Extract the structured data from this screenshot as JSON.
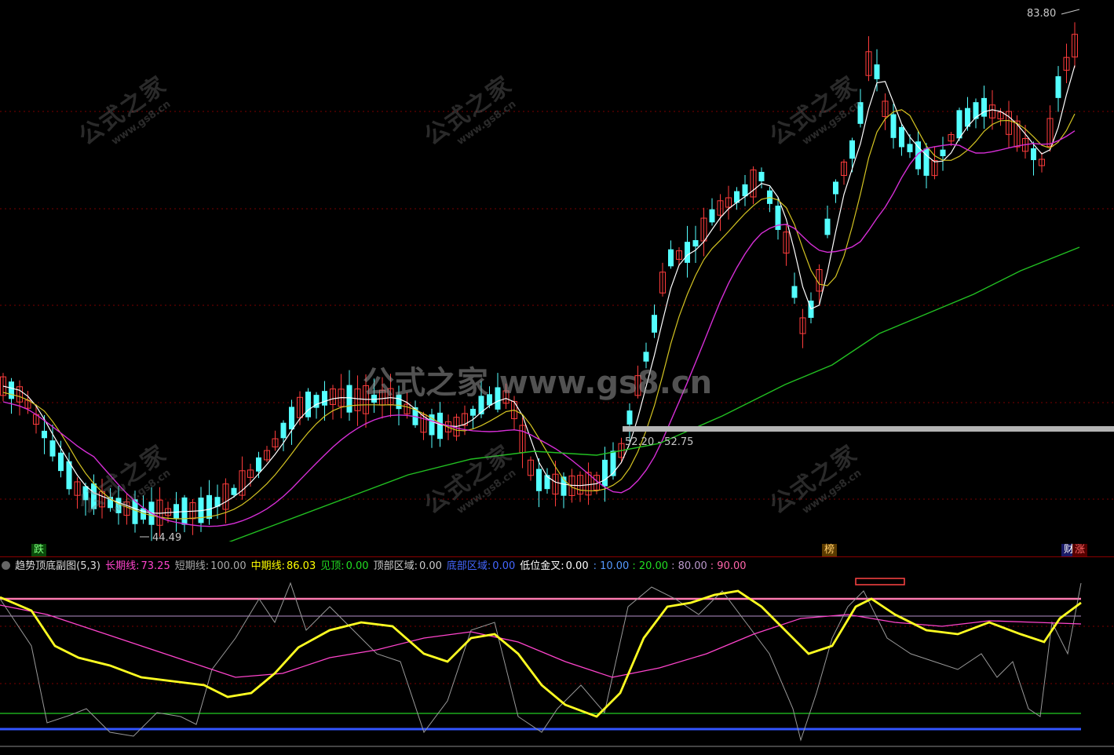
{
  "colors": {
    "up": "#ff3c3c",
    "down": "#54ffff",
    "ma5": "#ffffff",
    "ma10": "#d4c422",
    "ma20": "#d62ed6",
    "ma60": "#22c022",
    "yellow": "#ffff00",
    "pink": "#ff6ec7",
    "grid": "#7a0000"
  },
  "main": {
    "high_label": "83.80",
    "low_label": "44.49",
    "zone_label": "52.20 - 52.75",
    "tags": [
      "跌",
      "榜",
      "财",
      "涨"
    ]
  },
  "watermark": {
    "center": "公式之家 www.gs8.cn",
    "tile_big": "公式之家",
    "tile_small": "www.gs8.cn"
  },
  "indicator": {
    "name": "趋势顶底副图(5,3)",
    "items": [
      {
        "label": "长期线:",
        "value": "73.25",
        "color": "#ff44cc"
      },
      {
        "label": "短期线:",
        "value": "100.00",
        "color": "#aaaaaa"
      },
      {
        "label": "中期线:",
        "value": "86.03",
        "color": "#ffff00"
      },
      {
        "label": "见顶:",
        "value": "0.00",
        "color": "#22dd22"
      },
      {
        "label": "顶部区域:",
        "value": "0.00",
        "color": "#cccccc"
      },
      {
        "label": "底部区域:",
        "value": "0.00",
        "color": "#4466ff"
      },
      {
        "label": "低位金叉:",
        "value": "0.00",
        "color": "#ffffff"
      }
    ],
    "levels": [
      {
        "value": ": 10.00",
        "color": "#5599ff"
      },
      {
        "value": ": 20.00",
        "color": "#22dd22"
      },
      {
        "value": ": 80.00",
        "color": "#bb99cc"
      },
      {
        "value": ": 90.00",
        "color": "#ff66aa"
      }
    ]
  }
}
